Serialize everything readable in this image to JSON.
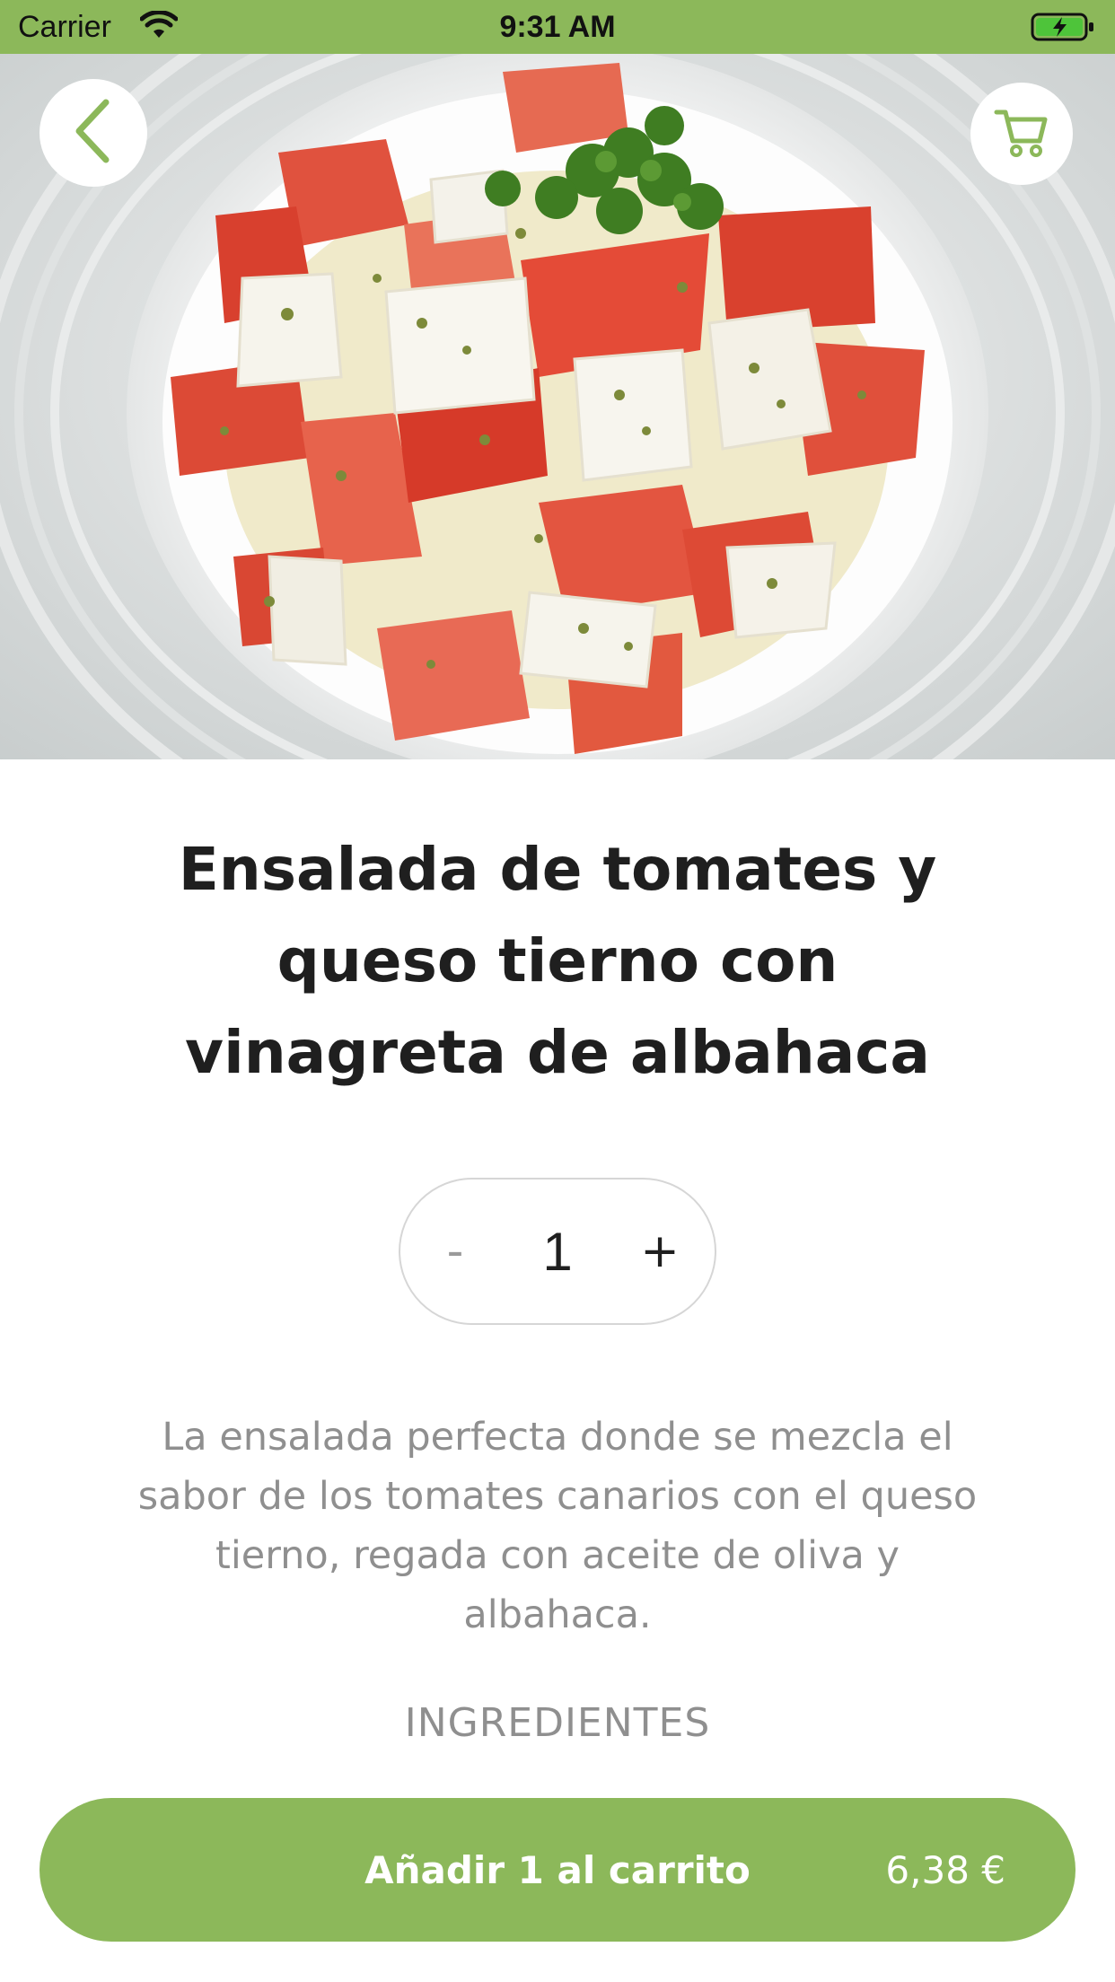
{
  "status_bar": {
    "carrier": "Carrier",
    "time": "9:31 AM",
    "wifi_icon": "wifi-icon",
    "battery_icon": "battery-charging-icon"
  },
  "nav": {
    "back_icon": "chevron-left-icon",
    "cart_icon": "shopping-cart-icon"
  },
  "hero_image": {
    "subject": "tomato and fresh cheese salad with parsley in a white bowl"
  },
  "product": {
    "title": "Ensalada de tomates y queso tierno con vinagreta de albahaca",
    "description": "La ensalada perfecta donde se mezcla el sabor de los tomates canarios con el queso tierno, regada con aceite de oliva y albahaca.",
    "ingredients_heading": "INGREDIENTES"
  },
  "stepper": {
    "minus_label": "-",
    "quantity": "1",
    "plus_label": "+"
  },
  "add_to_cart": {
    "label": "Añadir 1 al carrito",
    "price": "6,38 €"
  },
  "colors": {
    "accent": "#8cb85a",
    "title": "#1f1f1f",
    "muted_text": "#8f8f8f",
    "stepper_border": "#d6d6d6"
  }
}
